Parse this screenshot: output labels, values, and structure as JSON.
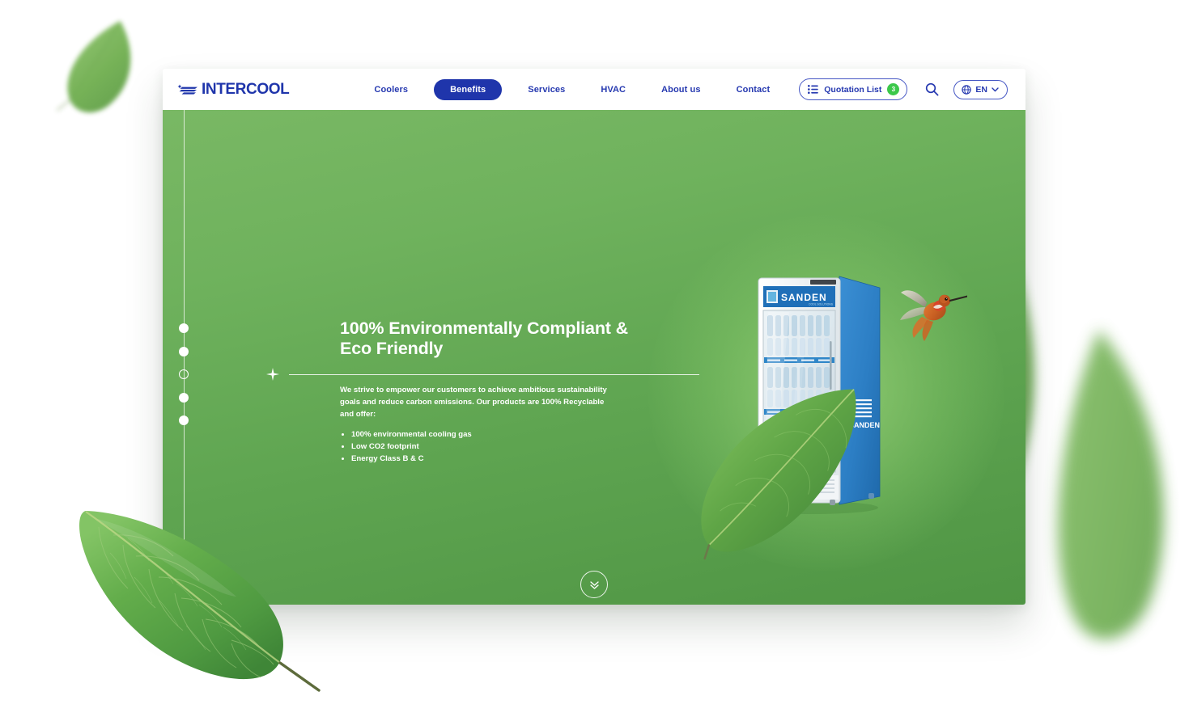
{
  "brand": {
    "name": "INTERCOOL",
    "logo_icon": "intercool-mark-icon",
    "color": "#1f35ab"
  },
  "header": {
    "nav": [
      {
        "label": "Coolers",
        "active": false
      },
      {
        "label": "Benefits",
        "active": true
      },
      {
        "label": "Services",
        "active": false
      },
      {
        "label": "HVAC",
        "active": false
      },
      {
        "label": "About us",
        "active": false
      },
      {
        "label": "Contact",
        "active": false
      }
    ],
    "quotation": {
      "label": "Quotation List",
      "count": "3",
      "list_icon": "list-icon",
      "badge_color": "#3cc84a"
    },
    "search": {
      "icon": "search-icon"
    },
    "language": {
      "code": "EN",
      "globe_icon": "globe-icon",
      "chevron_icon": "chevron-down-icon"
    },
    "accent_color": "#1f35ab"
  },
  "hero": {
    "title": "100% Environmentally Compliant & Eco Friendly",
    "paragraph": "We strive to empower our customers to achieve ambitious sustainability goals and reduce carbon emissions. Our products are 100% Recyclable and offer:",
    "bullets": [
      "100% environmental cooling gas",
      "Low CO2 footprint",
      "Energy Class B & C"
    ],
    "divider_icon": "sparkle-icon",
    "slides": [
      {
        "index": "1",
        "current": false
      },
      {
        "index": "2",
        "current": false
      },
      {
        "index": "3",
        "current": true
      },
      {
        "index": "4",
        "current": false
      },
      {
        "index": "5",
        "current": false
      }
    ],
    "product": {
      "brand": "SANDEN",
      "tagline": "COOL SOLUTIONS",
      "image_name": "sanden-cooler-image"
    },
    "hummingbird_image": "hummingbird-image",
    "scroll_down_icon": "double-chevron-down-icon",
    "gradient_top": "#79b864",
    "gradient_bottom": "#4f9544"
  },
  "decor": {
    "leaves": [
      {
        "name": "leaf-top-left"
      },
      {
        "name": "leaf-right-upper"
      },
      {
        "name": "leaf-right-lower"
      },
      {
        "name": "leaf-near-hummingbird"
      },
      {
        "name": "leaf-over-cooler"
      },
      {
        "name": "leaf-foreground-bottom-left"
      }
    ]
  }
}
